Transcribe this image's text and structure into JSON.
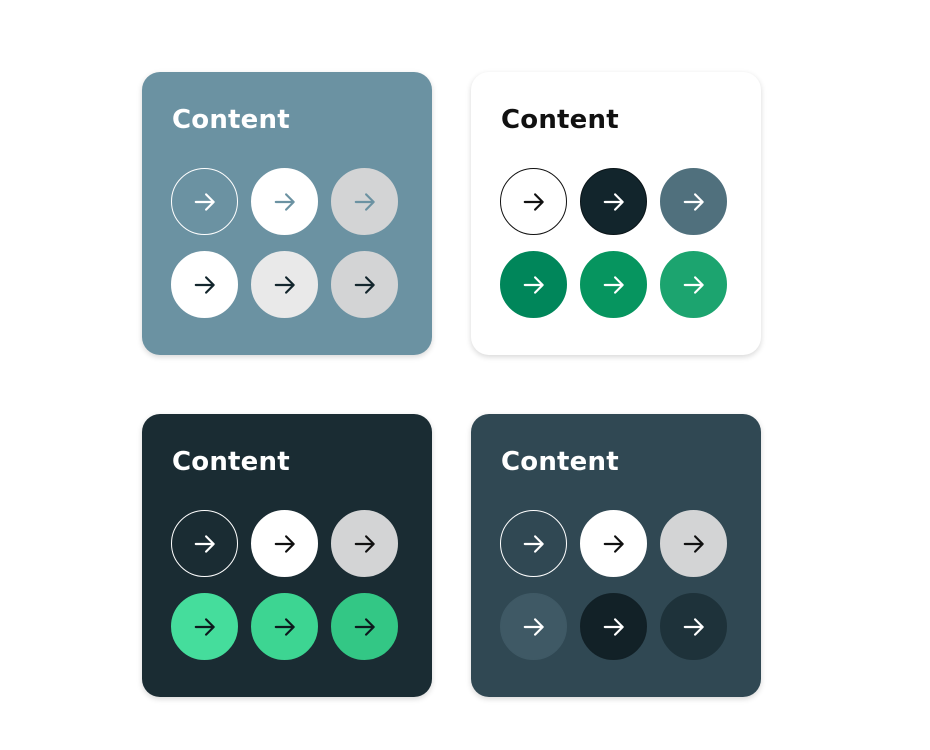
{
  "cards": [
    {
      "id": "slate",
      "title": "Content",
      "background": "#6B92A2",
      "title_color": "#FFFFFF",
      "buttons": [
        {
          "style": "outline",
          "fill": "transparent",
          "border": "#FFFFFF",
          "arrow": "#FFFFFF",
          "icon": "arrow-right-icon"
        },
        {
          "style": "solid",
          "fill": "#FFFFFF",
          "border": "#FFFFFF",
          "arrow": "#6B92A2",
          "icon": "arrow-right-icon"
        },
        {
          "style": "solid",
          "fill": "#D3D4D5",
          "border": "#D3D4D5",
          "arrow": "#6B92A2",
          "icon": "arrow-right-icon"
        },
        {
          "style": "solid",
          "fill": "#FFFFFF",
          "border": "#FFFFFF",
          "arrow": "#13262D",
          "icon": "arrow-right-icon"
        },
        {
          "style": "solid",
          "fill": "#E9E9E9",
          "border": "#E9E9E9",
          "arrow": "#13262D",
          "icon": "arrow-right-icon"
        },
        {
          "style": "solid",
          "fill": "#D3D4D5",
          "border": "#D3D4D5",
          "arrow": "#13262D",
          "icon": "arrow-right-icon"
        }
      ]
    },
    {
      "id": "white",
      "title": "Content",
      "background": "#FFFFFF",
      "title_color": "#111111",
      "buttons": [
        {
          "style": "outline",
          "fill": "#FFFFFF",
          "border": "#111111",
          "arrow": "#111111",
          "icon": "arrow-right-icon"
        },
        {
          "style": "solid",
          "fill": "#12252C",
          "border": "#0A1418",
          "arrow": "#FFFFFF",
          "icon": "arrow-right-icon"
        },
        {
          "style": "solid",
          "fill": "#50707D",
          "border": "#50707D",
          "arrow": "#FFFFFF",
          "icon": "arrow-right-icon"
        },
        {
          "style": "solid",
          "fill": "#00865A",
          "border": "#00865A",
          "arrow": "#FFFFFF",
          "icon": "arrow-right-icon"
        },
        {
          "style": "solid",
          "fill": "#06955F",
          "border": "#06955F",
          "arrow": "#FFFFFF",
          "icon": "arrow-right-icon"
        },
        {
          "style": "solid",
          "fill": "#1CA46F",
          "border": "#1CA46F",
          "arrow": "#FFFFFF",
          "icon": "arrow-right-icon"
        }
      ]
    },
    {
      "id": "dark",
      "title": "Content",
      "background": "#1A2C33",
      "title_color": "#FFFFFF",
      "buttons": [
        {
          "style": "outline",
          "fill": "transparent",
          "border": "#FFFFFF",
          "arrow": "#FFFFFF",
          "icon": "arrow-right-icon"
        },
        {
          "style": "solid",
          "fill": "#FFFFFF",
          "border": "#FFFFFF",
          "arrow": "#111111",
          "icon": "arrow-right-icon"
        },
        {
          "style": "solid",
          "fill": "#D3D4D5",
          "border": "#D3D4D5",
          "arrow": "#111111",
          "icon": "arrow-right-icon"
        },
        {
          "style": "solid",
          "fill": "#45DD9C",
          "border": "#45DD9C",
          "arrow": "#0E1A1E",
          "icon": "arrow-right-icon"
        },
        {
          "style": "solid",
          "fill": "#3DD592",
          "border": "#3DD592",
          "arrow": "#0E1A1E",
          "icon": "arrow-right-icon"
        },
        {
          "style": "solid",
          "fill": "#33C785",
          "border": "#33C785",
          "arrow": "#0E1A1E",
          "icon": "arrow-right-icon"
        }
      ]
    },
    {
      "id": "charcoal",
      "title": "Content",
      "background": "#304853",
      "title_color": "#FFFFFF",
      "buttons": [
        {
          "style": "outline",
          "fill": "transparent",
          "border": "#FFFFFF",
          "arrow": "#FFFFFF",
          "icon": "arrow-right-icon"
        },
        {
          "style": "solid",
          "fill": "#FFFFFF",
          "border": "#FFFFFF",
          "arrow": "#111111",
          "icon": "arrow-right-icon"
        },
        {
          "style": "solid",
          "fill": "#D3D4D5",
          "border": "#D3D4D5",
          "arrow": "#111111",
          "icon": "arrow-right-icon"
        },
        {
          "style": "solid",
          "fill": "#3F5965",
          "border": "#3F5965",
          "arrow": "#FFFFFF",
          "icon": "arrow-right-icon"
        },
        {
          "style": "solid",
          "fill": "#122127",
          "border": "#122127",
          "arrow": "#FFFFFF",
          "icon": "arrow-right-icon"
        },
        {
          "style": "solid",
          "fill": "#1E323A",
          "border": "#1E323A",
          "arrow": "#FFFFFF",
          "icon": "arrow-right-icon"
        }
      ]
    }
  ]
}
